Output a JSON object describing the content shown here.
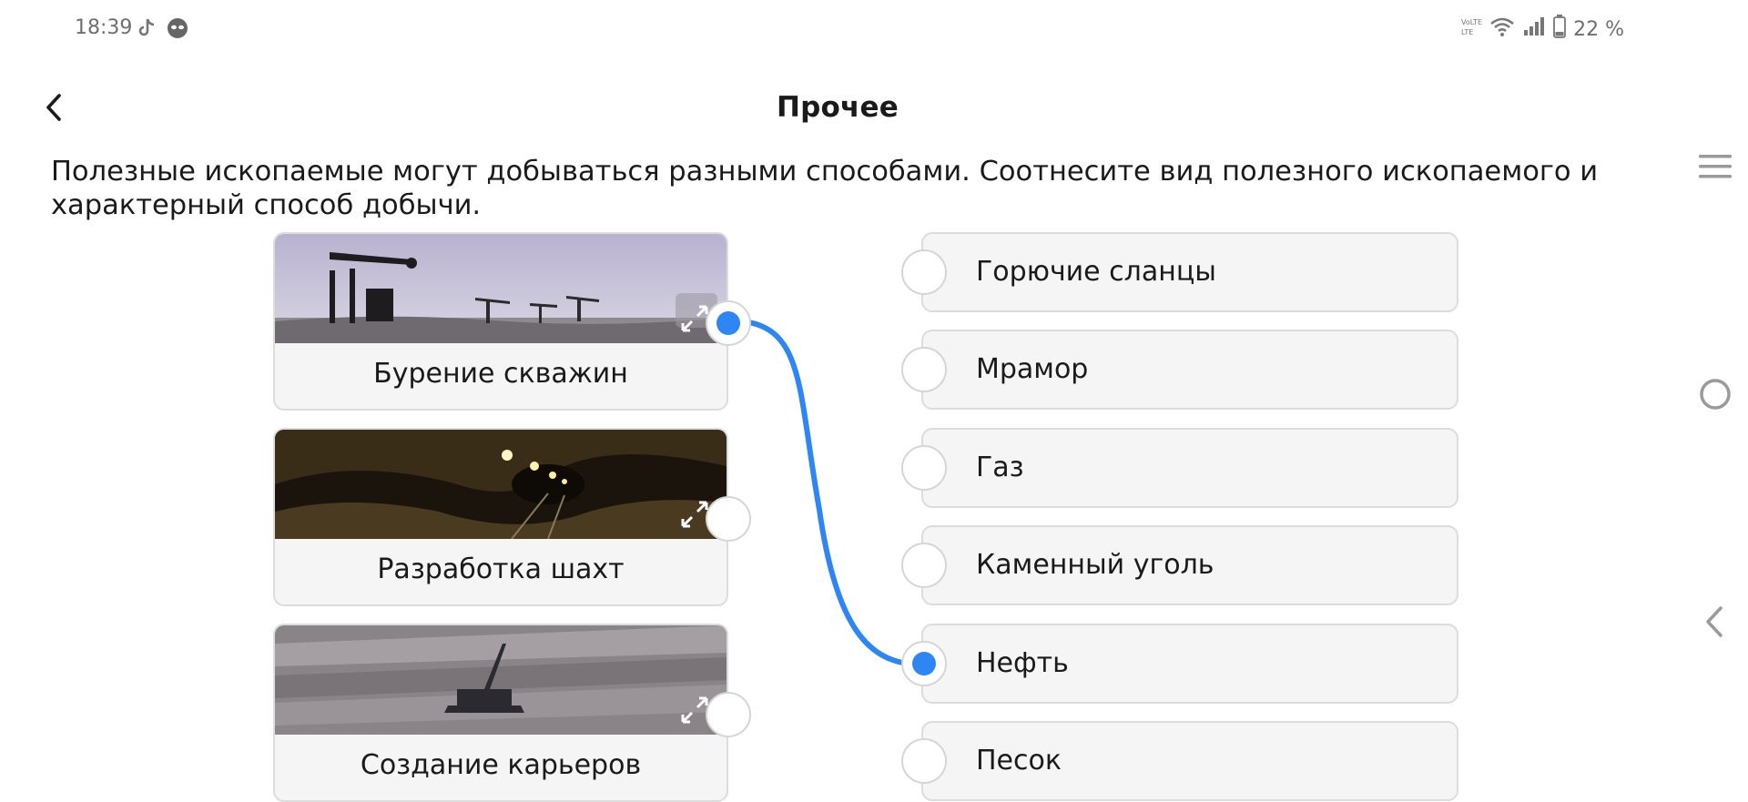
{
  "status_bar": {
    "time": "18:39",
    "app_icons": [
      "tiktok-icon",
      "alien-icon"
    ],
    "right_icons": [
      "volte-icon",
      "wifi-icon",
      "signal-icon",
      "battery-icon"
    ],
    "battery": "22 %"
  },
  "header": {
    "title": "Прочее",
    "back_icon": "chevron-left-icon"
  },
  "question": {
    "text": "Полезные ископаемые могут добываться разными способами. Соотнесите вид полезного ископаемого и характерный способ добычи."
  },
  "left_items": [
    {
      "label": "Бурение скважин",
      "image": "oil-pumpjacks-photo",
      "connected": true
    },
    {
      "label": "Разработка шахт",
      "image": "mine-tunnel-photo",
      "connected": false
    },
    {
      "label": "Создание карьеров",
      "image": "open-pit-excavator-photo",
      "connected": false
    }
  ],
  "right_items": [
    {
      "label": "Горючие сланцы",
      "connected": false
    },
    {
      "label": "Мрамор",
      "connected": false
    },
    {
      "label": "Газ",
      "connected": false
    },
    {
      "label": "Каменный уголь",
      "connected": false
    },
    {
      "label": "Нефть",
      "connected": true
    },
    {
      "label": "Песок",
      "connected": false
    }
  ],
  "connections": [
    {
      "from": "Бурение скважин",
      "to": "Нефть"
    }
  ],
  "colors": {
    "accent": "#2e86f5",
    "card_bg": "#f5f5f5",
    "card_border": "#dcdcdc"
  },
  "side_nav": [
    "menu-icon",
    "home-circle-icon",
    "back-arrow-icon"
  ]
}
